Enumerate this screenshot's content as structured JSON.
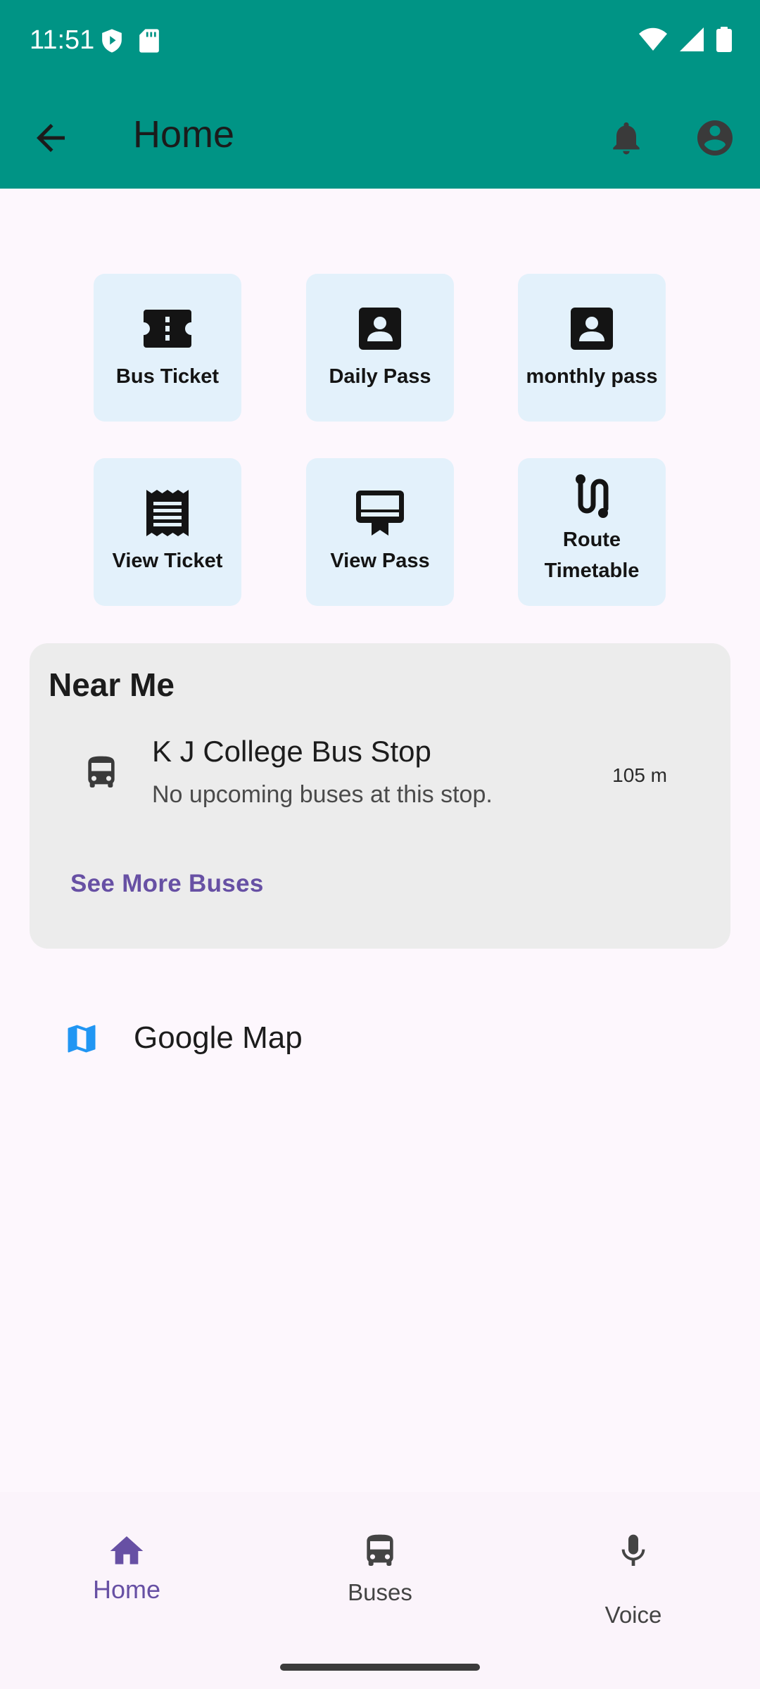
{
  "status_bar": {
    "time": "11:51"
  },
  "app_bar": {
    "title": "Home"
  },
  "tiles": [
    {
      "label": "Bus Ticket",
      "icon": "ticket-icon"
    },
    {
      "label": "Daily Pass",
      "icon": "badge-icon"
    },
    {
      "label": "monthly pass",
      "icon": "badge-icon"
    },
    {
      "label": "View Ticket",
      "icon": "receipt-icon"
    },
    {
      "label": "View Pass",
      "icon": "card-pass-icon"
    },
    {
      "label": "Route Timetable",
      "icon": "route-icon"
    }
  ],
  "near_me": {
    "title": "Near Me",
    "stop_name": "K J College Bus Stop",
    "stop_status": "No upcoming buses at this stop.",
    "distance": "105 m",
    "see_more": "See More Buses"
  },
  "google_map": {
    "label": "Google Map",
    "icon": "map-icon"
  },
  "bottom_nav": {
    "items": [
      {
        "label": "Home",
        "icon": "home-icon",
        "active": true
      },
      {
        "label": "Buses",
        "icon": "bus-icon",
        "active": false
      },
      {
        "label": "Voice",
        "icon": "mic-icon",
        "active": false
      }
    ]
  },
  "colors": {
    "app_bar": "#009485",
    "tile_bg": "#e3f1fb",
    "accent": "#6750a4",
    "card_bg": "#ececec",
    "background": "#fdf7fd"
  }
}
